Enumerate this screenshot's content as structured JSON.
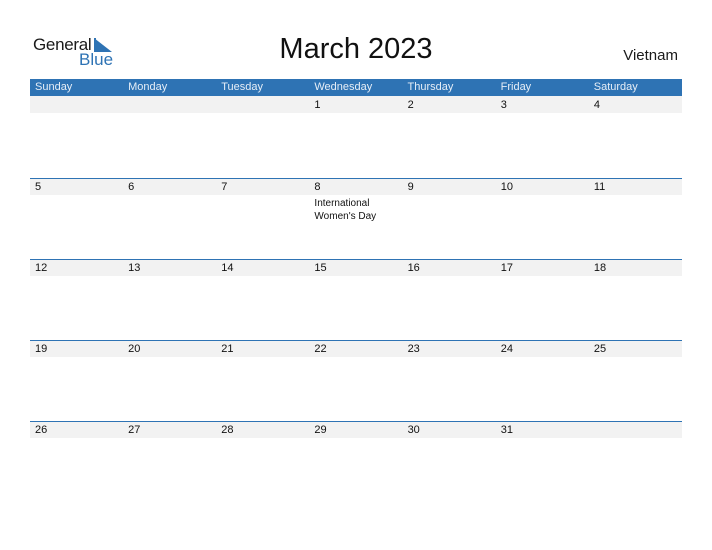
{
  "logo": {
    "word1": "General",
    "word2": "Blue"
  },
  "title": "March 2023",
  "country": "Vietnam",
  "colors": {
    "accent": "#2e73b4",
    "strip": "#f2f2f2"
  },
  "weekdays": [
    "Sunday",
    "Monday",
    "Tuesday",
    "Wednesday",
    "Thursday",
    "Friday",
    "Saturday"
  ],
  "weeks": [
    [
      {
        "d": ""
      },
      {
        "d": ""
      },
      {
        "d": ""
      },
      {
        "d": "1"
      },
      {
        "d": "2"
      },
      {
        "d": "3"
      },
      {
        "d": "4"
      }
    ],
    [
      {
        "d": "5"
      },
      {
        "d": "6"
      },
      {
        "d": "7"
      },
      {
        "d": "8",
        "event": "International Women's Day"
      },
      {
        "d": "9"
      },
      {
        "d": "10"
      },
      {
        "d": "11"
      }
    ],
    [
      {
        "d": "12"
      },
      {
        "d": "13"
      },
      {
        "d": "14"
      },
      {
        "d": "15"
      },
      {
        "d": "16"
      },
      {
        "d": "17"
      },
      {
        "d": "18"
      }
    ],
    [
      {
        "d": "19"
      },
      {
        "d": "20"
      },
      {
        "d": "21"
      },
      {
        "d": "22"
      },
      {
        "d": "23"
      },
      {
        "d": "24"
      },
      {
        "d": "25"
      }
    ],
    [
      {
        "d": "26"
      },
      {
        "d": "27"
      },
      {
        "d": "28"
      },
      {
        "d": "29"
      },
      {
        "d": "30"
      },
      {
        "d": "31"
      },
      {
        "d": ""
      }
    ]
  ]
}
